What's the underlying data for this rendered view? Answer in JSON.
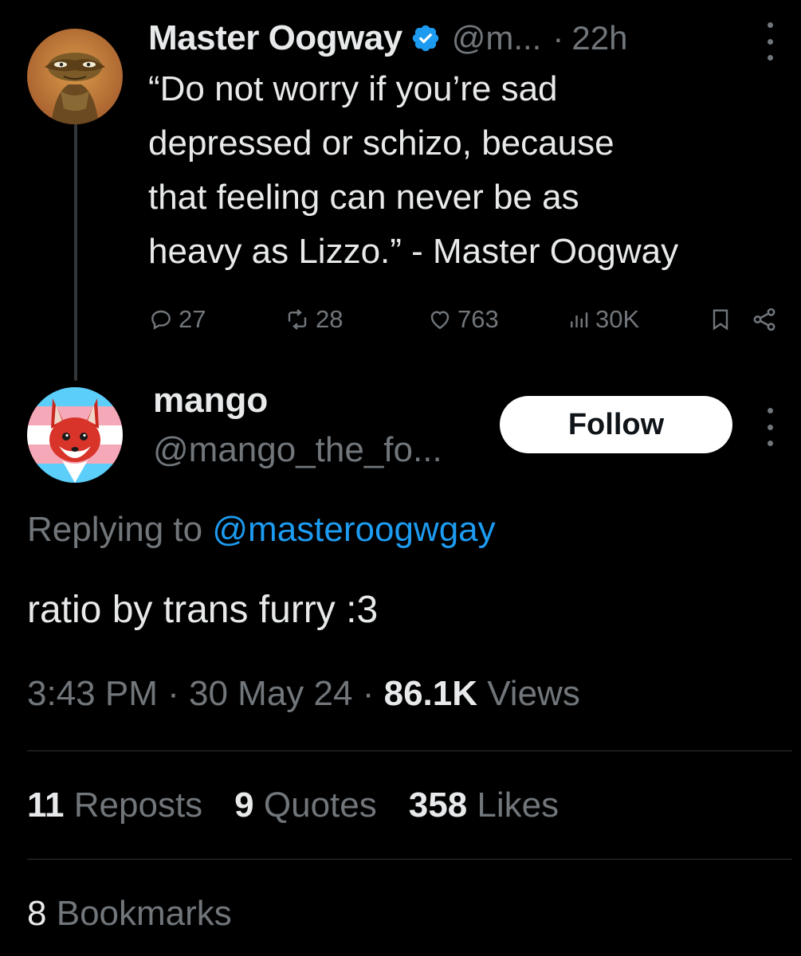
{
  "parent_tweet": {
    "author_name": "Master Oogway",
    "handle": "@m...",
    "separator": "·",
    "time": "22h",
    "verified": true,
    "avatar": "master-oogway-avatar",
    "text_lines": [
      "“Do not worry if you’re sad",
      "depressed or schizo, because",
      "that feeling can never be as",
      "heavy as Lizzo.” - Master Oogway"
    ],
    "actions": {
      "replies": "27",
      "reposts": "28",
      "likes": "763",
      "views": "30K"
    }
  },
  "reply_tweet": {
    "author_name": "mango",
    "handle": "@mango_the_fo...",
    "avatar": "mango-fox-avatar",
    "follow_label": "Follow",
    "replying_prefix": "Replying to",
    "replying_to": "@masteroogwgay",
    "text": "ratio by trans furry :3",
    "timestamp": "3:43 PM",
    "date": "30 May 24",
    "dot": "·",
    "views_count": "86.1K",
    "views_label": "Views",
    "reposts_count": "11",
    "reposts_label": "Reposts",
    "quotes_count": "9",
    "quotes_label": "Quotes",
    "likes_count": "358",
    "likes_label": "Likes",
    "bookmarks_count": "8",
    "bookmarks_label": "Bookmarks"
  },
  "colors": {
    "background": "#000000",
    "text_primary": "#e7e9ea",
    "text_secondary": "#71767b",
    "link": "#1d9bf0",
    "verified": "#1d9bf0",
    "divider": "#2f3336"
  }
}
